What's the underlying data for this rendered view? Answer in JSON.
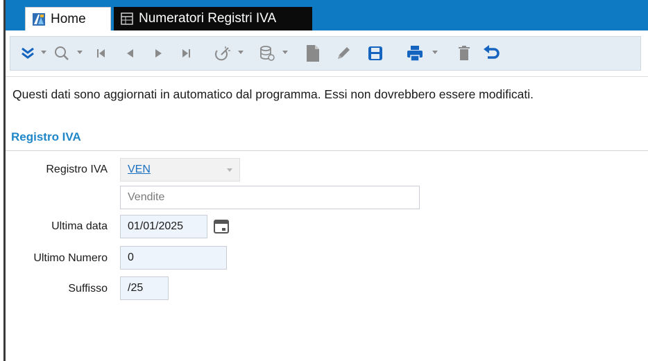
{
  "tabs": [
    {
      "label": "Home",
      "icon": "app-logo-icon",
      "active": false
    },
    {
      "label": "Numeratori Registri IVA",
      "icon": "table-icon",
      "active": true
    }
  ],
  "toolbar": {
    "items": [
      "expand-icon",
      "search-icon",
      "first-record-icon",
      "previous-record-icon",
      "next-record-icon",
      "last-record-icon",
      "filter-icon",
      "database-icon",
      "new-document-icon",
      "edit-icon",
      "save-icon",
      "print-icon",
      "delete-icon",
      "undo-icon"
    ]
  },
  "notice": "Questi dati sono aggiornati in automatico dal programma. Essi non dovrebbero essere modificati.",
  "section": {
    "title": "Registro IVA"
  },
  "form": {
    "registro": {
      "label": "Registro IVA",
      "value": "VEN",
      "description": "Vendite"
    },
    "ultima_data": {
      "label": "Ultima data",
      "value": "01/01/2025"
    },
    "ultimo_numero": {
      "label": "Ultimo Numero",
      "value": "0"
    },
    "suffisso": {
      "label": "Suffisso",
      "value": "/25"
    }
  },
  "colors": {
    "accent": "#0e7ac4",
    "section_title": "#1f86c8",
    "icon_primary": "#1565c0",
    "field_fill": "#eef4fb"
  }
}
